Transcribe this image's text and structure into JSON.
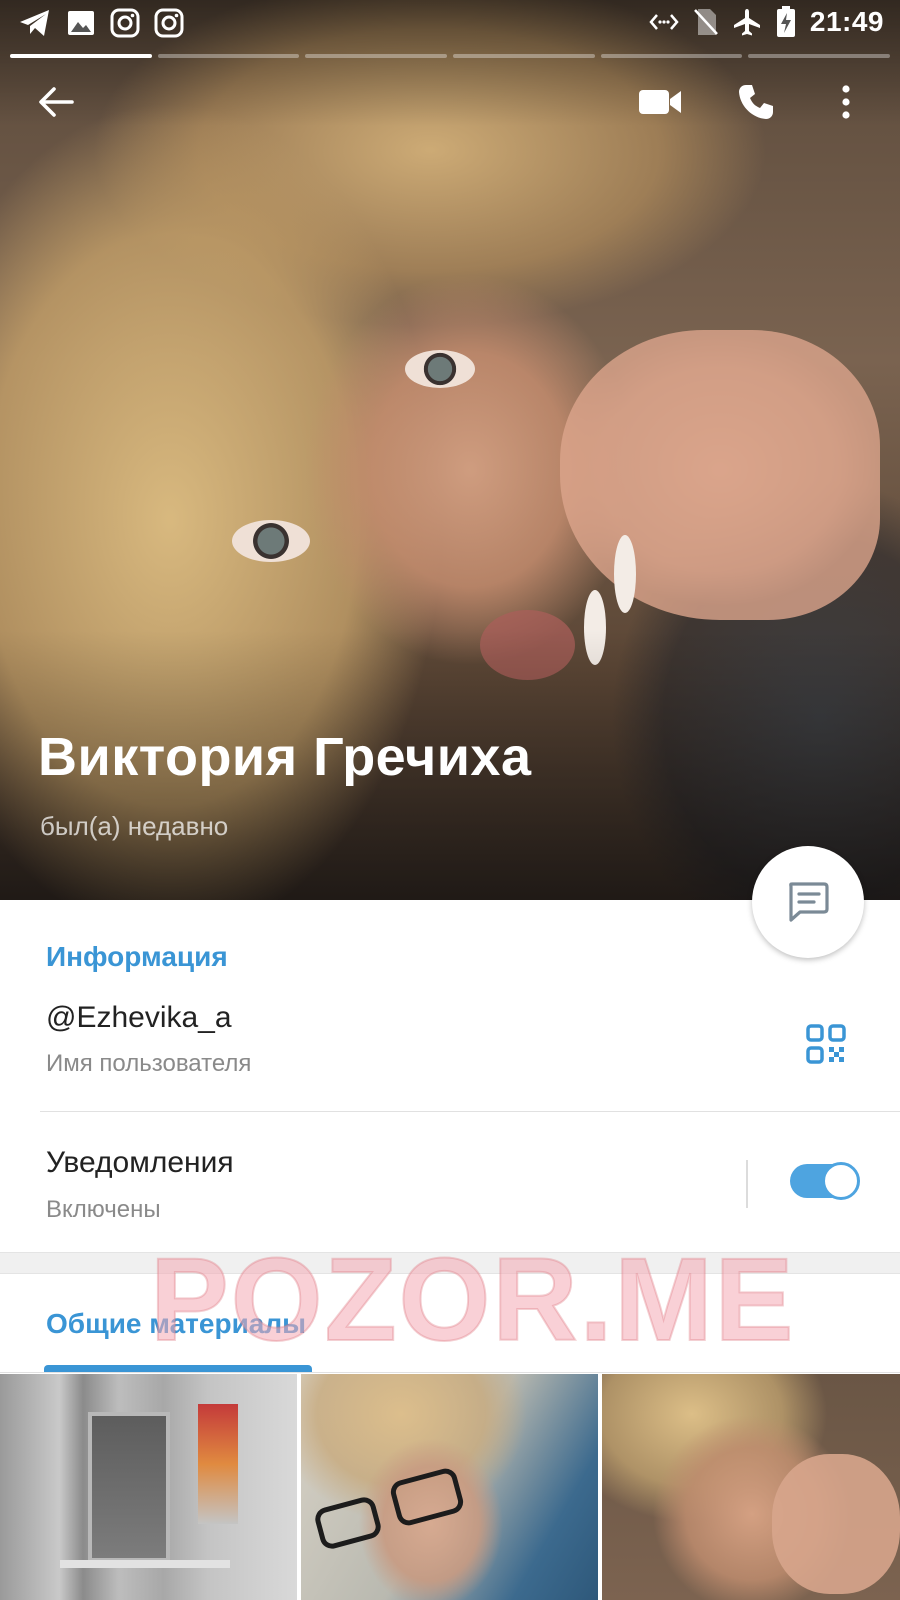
{
  "status_bar": {
    "time": "21:49",
    "left_icons": [
      "telegram-icon",
      "gallery-icon",
      "instagram-icon",
      "instagram-icon"
    ],
    "right_icons": [
      "data-transfer-icon",
      "no-sim-icon",
      "airplane-icon",
      "battery-charging-icon"
    ]
  },
  "story": {
    "segments": 6,
    "active_index": 0
  },
  "profile": {
    "name": "Виктория Гречиха",
    "status": "был(а) недавно"
  },
  "info": {
    "header": "Информация",
    "username": "@Ezhevika_a",
    "username_label": "Имя пользователя",
    "notifications_title": "Уведомления",
    "notifications_state": "Включены",
    "notifications_enabled": true
  },
  "shared": {
    "tab_label": "Общие материалы",
    "thumbnails": 3
  },
  "watermark": "POZOR.ME",
  "colors": {
    "accent": "#3a95d5",
    "toggle": "#4ea4e0"
  }
}
